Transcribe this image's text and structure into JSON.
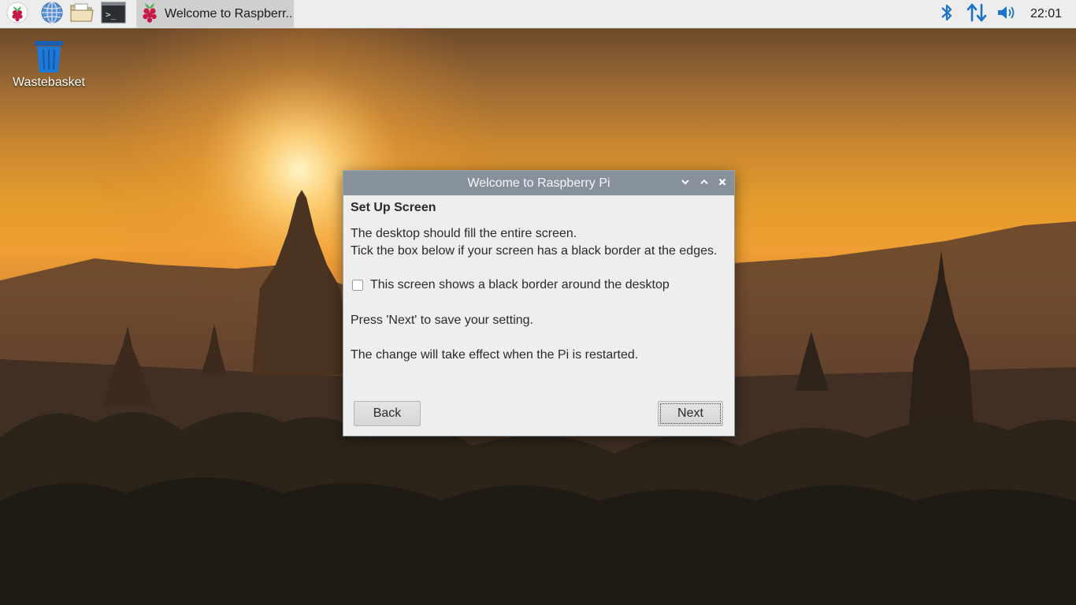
{
  "taskbar": {
    "launchers": {
      "menu_icon": "raspberry-icon",
      "browser_icon": "globe-icon",
      "files_icon": "folder-icon",
      "terminal_icon": "terminal-icon",
      "terminal_prompt": ">_"
    },
    "tasks": [
      {
        "label": "Welcome to Raspberr..."
      }
    ],
    "tray": {
      "bluetooth_icon": "bluetooth-icon",
      "network_icon": "network-arrows-icon",
      "volume_icon": "volume-icon",
      "clock": "22:01",
      "accent_color": "#1a73c8"
    }
  },
  "desktop": {
    "icons": [
      {
        "label": "Wastebasket",
        "icon": "wastebasket-icon"
      }
    ]
  },
  "dialog": {
    "title": "Welcome to Raspberry Pi",
    "heading": "Set Up Screen",
    "line1": "The desktop should fill the entire screen.",
    "line2": "Tick the box below if your screen has a black border at the edges.",
    "checkbox": {
      "label": "This screen shows a black border around the desktop",
      "checked": false
    },
    "line3": "Press 'Next' to save your setting.",
    "line4": "The change will take effect when the Pi is restarted.",
    "back_label": "Back",
    "next_label": "Next"
  }
}
